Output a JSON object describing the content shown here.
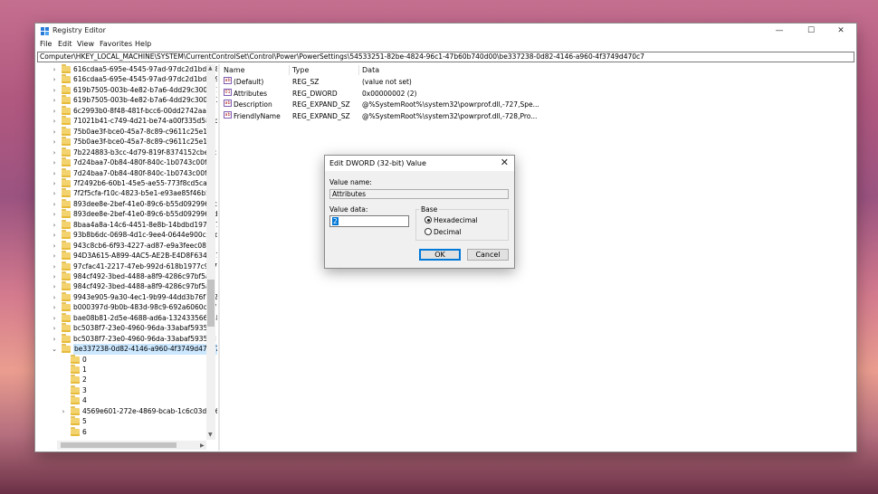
{
  "window": {
    "title": "Registry Editor",
    "min": "—",
    "max": "☐",
    "close": "✕"
  },
  "menu": [
    "File",
    "Edit",
    "View",
    "Favorites",
    "Help"
  ],
  "address": "Computer\\HKEY_LOCAL_MACHINE\\SYSTEM\\CurrentControlSet\\Control\\Power\\PowerSettings\\54533251-82be-4824-96c1-47b60b740d00\\be337238-0d82-4146-a960-4f3749d470c7",
  "tree": [
    {
      "label": "616cdaa5-695e-4545-97ad-97dc2d1bdd88",
      "expandable": true
    },
    {
      "label": "616cdaa5-695e-4545-97ad-97dc2d1bdd89",
      "expandable": true
    },
    {
      "label": "619b7505-003b-4e82-b7a6-4dd29c300971",
      "expandable": true
    },
    {
      "label": "619b7505-003b-4e82-b7a6-4dd29c300972",
      "expandable": true
    },
    {
      "label": "6c2993b0-8f48-481f-bcc6-00dd2742aa06",
      "expandable": true
    },
    {
      "label": "71021b41-c749-4d21-be74-a00f335d582b",
      "expandable": true
    },
    {
      "label": "75b0ae3f-bce0-45a7-8c89-c9611c25e100",
      "expandable": true
    },
    {
      "label": "75b0ae3f-bce0-45a7-8c89-c9611c25e101",
      "expandable": true
    },
    {
      "label": "7b224883-b3cc-4d79-819f-8374152cbe7c",
      "expandable": true
    },
    {
      "label": "7d24baa7-0b84-480f-840c-1b0743c00f5f",
      "expandable": true
    },
    {
      "label": "7d24baa7-0b84-480f-840c-1b0743c00f60",
      "expandable": true
    },
    {
      "label": "7f2492b6-60b1-45e5-ae55-773f8cd5caec",
      "expandable": true
    },
    {
      "label": "7f2f5cfa-f10c-4823-b5e1-e93ae85f46b5",
      "expandable": true
    },
    {
      "label": "893dee8e-2bef-41e0-89c6-b55d0929964c",
      "expandable": true
    },
    {
      "label": "893dee8e-2bef-41e0-89c6-b55d0929964d",
      "expandable": true
    },
    {
      "label": "8baa4a8a-14c6-4451-8e8b-14bdbd197537",
      "expandable": true
    },
    {
      "label": "93b8b6dc-0698-4d1c-9ee4-0644e900c85d",
      "expandable": true
    },
    {
      "label": "943c8cb6-6f93-4227-ad87-e9a3feec08d1",
      "expandable": true
    },
    {
      "label": "94D3A615-A899-4AC5-AE2B-E4D8F634367F",
      "expandable": true
    },
    {
      "label": "97cfac41-2217-47eb-992d-618b1977c907",
      "expandable": true
    },
    {
      "label": "984cf492-3bed-4488-a8f9-4286c97bf5aa",
      "expandable": true
    },
    {
      "label": "984cf492-3bed-4488-a8f9-4286c97bf5ab",
      "expandable": true
    },
    {
      "label": "9943e905-9a30-4ec1-9b99-44dd3b76f7a2",
      "expandable": true
    },
    {
      "label": "b000397d-9b0b-483d-98c9-692a6060cfbf",
      "expandable": true
    },
    {
      "label": "bae08b81-2d5e-4688-ad6a-13243356654b",
      "expandable": true
    },
    {
      "label": "bc5038f7-23e0-4960-96da-33abaf5935ec",
      "expandable": true
    },
    {
      "label": "bc5038f7-23e0-4960-96da-33abaf5935ed",
      "expandable": true
    },
    {
      "label": "be337238-0d82-4146-a960-4f3749d470c7",
      "expandable": true,
      "expanded": true,
      "selected": true
    }
  ],
  "subtree": [
    {
      "label": "0"
    },
    {
      "label": "1"
    },
    {
      "label": "2"
    },
    {
      "label": "3"
    },
    {
      "label": "4"
    },
    {
      "label": "4569e601-272e-4869-bcab-1c6c03d7966f",
      "expandable": true
    },
    {
      "label": "5"
    },
    {
      "label": "6"
    }
  ],
  "columns": {
    "name": "Name",
    "type": "Type",
    "data": "Data"
  },
  "values": [
    {
      "name": "(Default)",
      "type": "REG_SZ",
      "data": "(value not set)"
    },
    {
      "name": "Attributes",
      "type": "REG_DWORD",
      "data": "0x00000002 (2)"
    },
    {
      "name": "Description",
      "type": "REG_EXPAND_SZ",
      "data": "@%SystemRoot%\\system32\\powrprof.dll,-727,Spe..."
    },
    {
      "name": "FriendlyName",
      "type": "REG_EXPAND_SZ",
      "data": "@%SystemRoot%\\system32\\powrprof.dll,-728,Pro..."
    }
  ],
  "dialog": {
    "title": "Edit DWORD (32-bit) Value",
    "close": "✕",
    "value_name_label": "Value name:",
    "value_name": "Attributes",
    "value_data_label": "Value data:",
    "value_data": "2",
    "base_label": "Base",
    "hex_label": "Hexadecimal",
    "dec_label": "Decimal",
    "ok": "OK",
    "cancel": "Cancel"
  }
}
